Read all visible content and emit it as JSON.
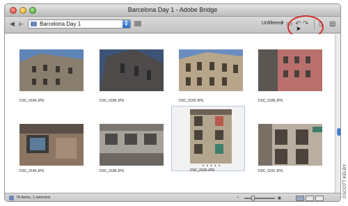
{
  "window": {
    "title": "Barcelona Day 1 - Adobe Bridge"
  },
  "toolbar": {
    "path_label": "Barcelona Day 1",
    "filter_label": "Unfiltered",
    "icons": [
      "back-arrow-icon",
      "forward-arrow-icon",
      "folder-icon",
      "reveal-folder-icon",
      "new-folder-icon",
      "rotate-left-icon",
      "rotate-right-icon",
      "trash-icon",
      "recent-files-icon"
    ]
  },
  "thumbnails": [
    {
      "filename": "DSC_0184.JPG"
    },
    {
      "filename": "DSC_0185.JPG"
    },
    {
      "filename": "DSC_0192.JPG"
    },
    {
      "filename": "DSC_0186.JPG"
    },
    {
      "filename": "DSC_0145.JPG"
    },
    {
      "filename": "DSC_0189.JPG"
    },
    {
      "filename": "DSC_0190.JPG",
      "selected": true
    },
    {
      "filename": "DSC_0191.JPG"
    }
  ],
  "status": {
    "text": "78 items, 1 selected"
  },
  "overlay": {
    "copyright": "©SCOTT KELBY",
    "annotation_color": "#d62a2a"
  }
}
